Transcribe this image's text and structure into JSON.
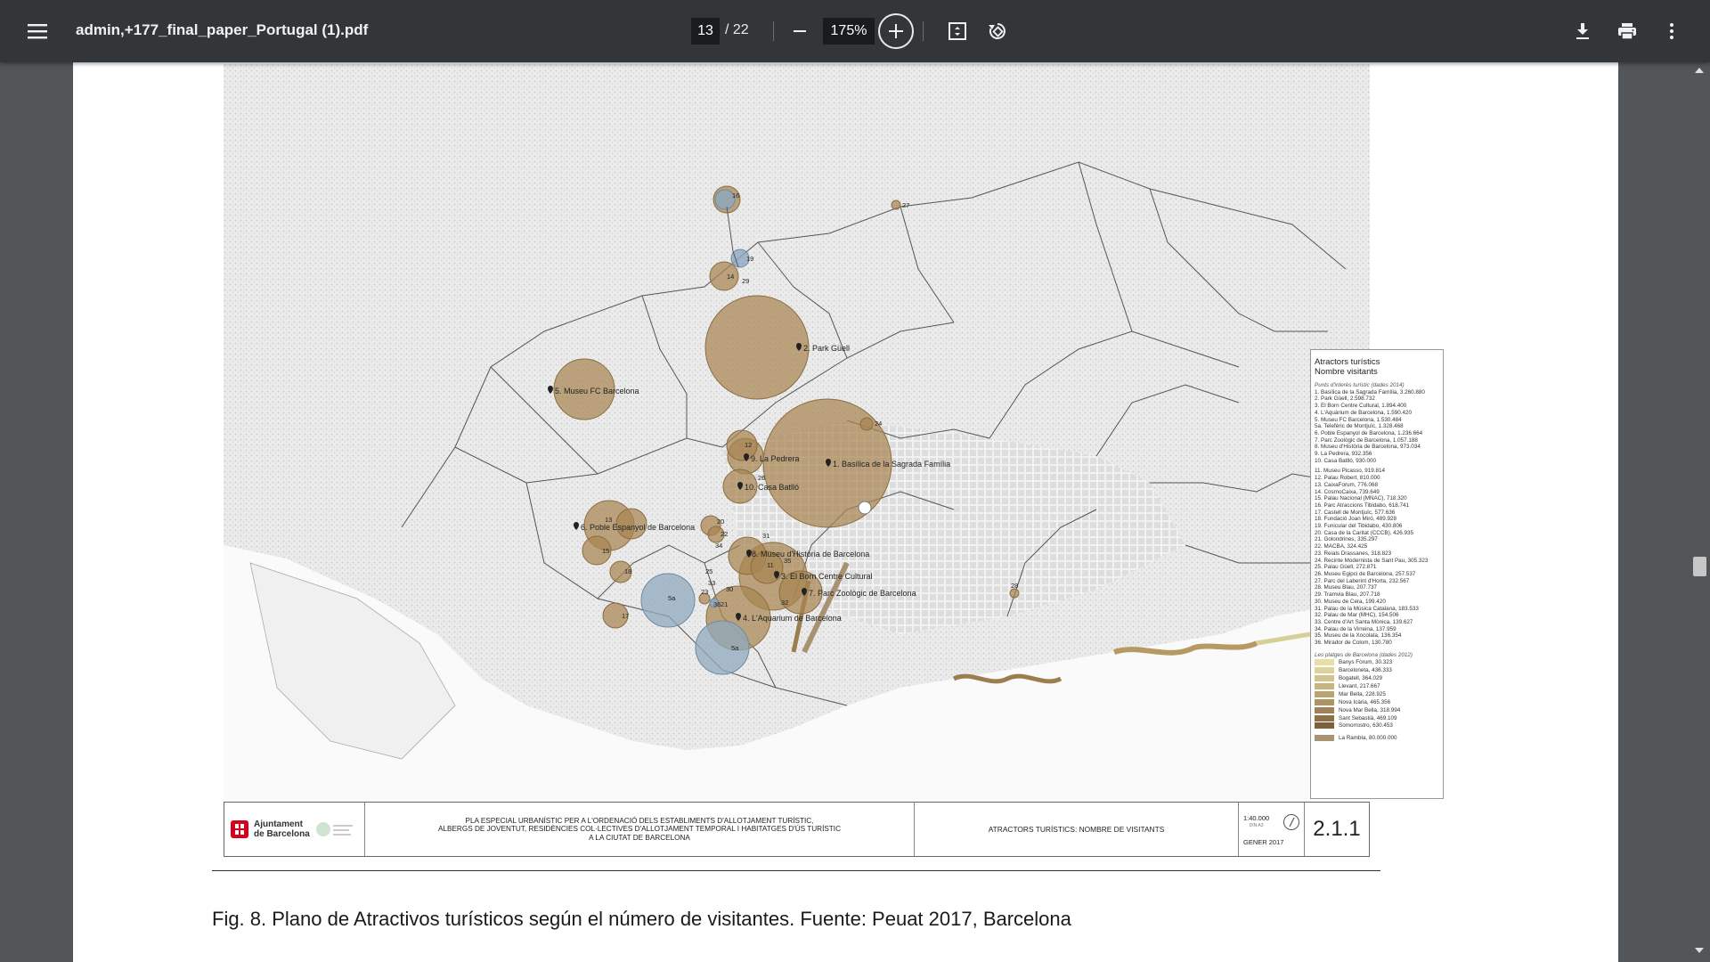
{
  "toolbar": {
    "filename": "admin,+177_final_paper_Portugal (1).pdf",
    "current_page": "13",
    "page_separator": "/ 22",
    "zoom": "175%"
  },
  "figure": {
    "map_labels": {
      "b1": "1. Basílica de la Sagrada Família",
      "b2": "2. Park Güell",
      "b3": "3. El Born Centre Cultural",
      "b4": "4. L'Aquarium de Barcelona",
      "b5": "5. Museu FC Barcelona",
      "b5a": "5a",
      "b5a2": "5a",
      "b6": "6. Poble Espanyol de Barcelona",
      "b7": "7. Parc Zoològic de Barcelona",
      "b8": "8. Museu d'Història de Barcelona",
      "b9": "9. La Pedrera",
      "b10": "10. Casa Batlló",
      "n11": "11",
      "n12": "12",
      "n13": "13",
      "n14": "14",
      "n15": "15",
      "n16": "16",
      "n17": "17",
      "n18": "18",
      "n19": "19",
      "n20": "20",
      "n21": "21",
      "n22": "22",
      "n23": "23",
      "n24": "24",
      "n25": "25",
      "n26": "26",
      "n27": "27",
      "n28": "28",
      "n29": "29",
      "n30": "30",
      "n31": "31",
      "n32": "32",
      "n33": "33",
      "n34": "34",
      "n35": "35",
      "n36": "36"
    },
    "legend": {
      "title1": "Atractors turístics",
      "title2": "Nombre visitants",
      "section1": "Punts d'interès turístic (dades 2014)",
      "items_a": [
        "1. Basílica de la Sagrada Família, 3.260.880",
        "2. Park Güell, 2.598.732",
        "3. El Born Centre Cultural, 1.894.400",
        "4. L'Aquàrium de Barcelona, 1.590.420",
        "5. Museu FC Barcelona, 1.530.484",
        "5a. Telefèric de Montjuïc, 1.328.468",
        "6. Poble Espanyol de Barcelona, 1.236.664",
        "7. Parc Zoològic de Barcelona, 1.057.188",
        "8. Museu d'Història de Barcelona, 973.034",
        "9. La Pedrera, 932.356",
        "10. Casa Batlló, 930.000"
      ],
      "items_b": [
        "11. Museu Picasso, 919.814",
        "12. Palau Robert, 810.000",
        "13. CaixaForum, 776.068",
        "14. CosmoCaixa, 739.649",
        "15. Palau Nacional (MNAC), 718.320",
        "16. Parc Atraccions Tibidabo, 618.741",
        "17. Castell de Montjuïc, 577.636",
        "18. Fundació Joan Miró, 489.928",
        "19. Funicular del Tibidabo, 430.806",
        "20. Casa de la Caritat (CCCB), 426.935",
        "21. Golondrines, 335.297",
        "22. MACBA, 324.425",
        "23. Reials Drassanes, 318.823",
        "24. Recinte Modernista de Sant Pau, 305.323",
        "25. Palau Güell, 272.871",
        "26. Museu Egipci de Barcelona, 257.537",
        "27. Parc del Laberint d'Horta, 232.567",
        "28. Museu Blau, 207.737",
        "29. Tramvia Blau, 207.718",
        "30. Museu de Cera, 199.420",
        "31. Palau de la Música Catalana, 183.533",
        "32. Palau de Mar (MHC), 154.506",
        "33. Centre d'Art Santa Mònica, 139.627",
        "34. Palau de la Virreina, 137.959",
        "35. Museu de la Xocolata, 136.354",
        "36. Mirador de Colom, 130.780"
      ],
      "section2": "Les platges de Barcelona (dades 2012)",
      "beaches": [
        {
          "label": "Banys Fòrum, 30.323",
          "color": "#e8dfa8"
        },
        {
          "label": "Barceloneta, 436.333",
          "color": "#ddd39a"
        },
        {
          "label": "Bogatell, 364.029",
          "color": "#d2c48c"
        },
        {
          "label": "Llevant, 217.667",
          "color": "#c7b47e"
        },
        {
          "label": "Mar Bella, 228.925",
          "color": "#bba370"
        },
        {
          "label": "Nova Icària, 465.356",
          "color": "#ad9262"
        },
        {
          "label": "Nova Mar Bella, 318.994",
          "color": "#9f8255"
        },
        {
          "label": "Sant Sebastià, 469.109",
          "color": "#8f7148"
        },
        {
          "label": "Somorrostro, 630.453",
          "color": "#7e613c"
        }
      ],
      "rambla": {
        "label": "La Rambla, 80.000.000",
        "color": "#a89272"
      }
    },
    "titleblock": {
      "logo_text1": "Ajuntament",
      "logo_text2": "de Barcelona",
      "plan_line1": "PLA ESPECIAL URBANÍSTIC PER A L'ORDENACIÓ DELS ESTABLIMENTS D'ALLOTJAMENT TURÍSTIC,",
      "plan_line2": "ALBERGS DE JOVENTUT, RESIDÈNCIES COL·LECTIVES D'ALLOTJAMENT TEMPORAL I HABITATGES D'ÚS TURÍSTIC",
      "plan_line3": "A LA CIUTAT DE BARCELONA",
      "sheet_title": "ATRACTORS TURÍSTICS: NOMBRE DE VISITANTS",
      "scale": "1:40.000",
      "scale_unit": "DIN A3",
      "date": "GENER 2017",
      "sheet_number": "2.1.1"
    },
    "caption": "Fig. 8. Plano de Atractivos turísticos según el número de visitantes. Fuente: Peuat 2017, Barcelona"
  },
  "colors": {
    "toolbar_bg": "#323639",
    "viewer_bg": "#525659",
    "bubble_brown": "#a88552",
    "bubble_blue": "#8fa9bf"
  },
  "icons": [
    "hamburger-menu-icon",
    "minus-icon",
    "plus-icon",
    "fit-page-icon",
    "rotate-icon",
    "download-icon",
    "print-icon",
    "more-vert-icon",
    "location-pin-icon",
    "compass-icon"
  ]
}
